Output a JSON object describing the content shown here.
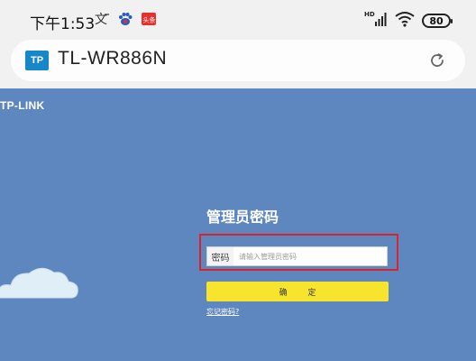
{
  "status_bar": {
    "time": "下午1:53",
    "notification_icons": [
      "translate-icon",
      "baidu-paw-icon",
      "toutiao-icon"
    ],
    "network": "HD",
    "battery": "80"
  },
  "address_bar": {
    "site_logo": "TP",
    "title": "TL-WR886N"
  },
  "page": {
    "brand": "TP-LINK",
    "login_title": "管理员密码",
    "password_label": "密码",
    "password_placeholder": "请输入管理员密码",
    "password_value": "",
    "confirm_label": "确 定",
    "forgot_link": "忘记密码?"
  },
  "colors": {
    "page_background": "#5f87bf",
    "confirm_button": "#f7e42c",
    "highlight_border": "#d8242a",
    "site_logo": "#1687c9"
  }
}
